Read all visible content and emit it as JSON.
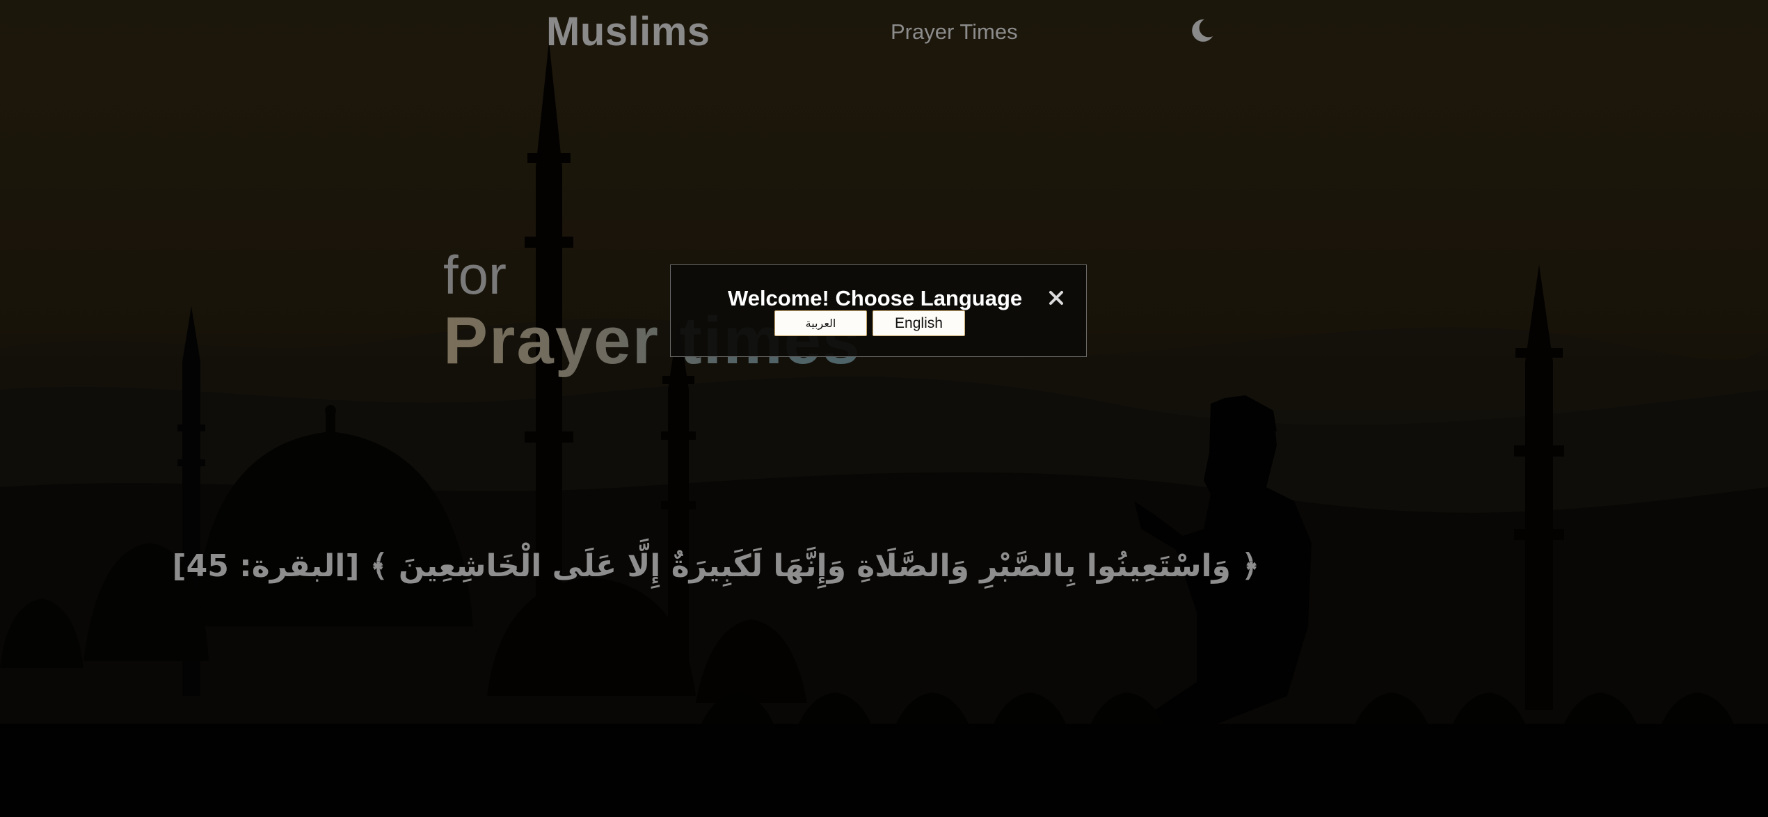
{
  "nav": {
    "brand": "Muslims",
    "links": [
      {
        "label": "Prayer Times"
      }
    ],
    "theme_toggle_icon": "moon-icon"
  },
  "hero": {
    "pre_title": "for",
    "title": "Prayer times"
  },
  "verse": {
    "text": "﴿ وَاسْتَعِينُوا بِالصَّبْرِ وَالصَّلَاةِ وَإِنَّهَا لَكَبِيرَةٌ إِلَّا عَلَى الْخَاشِعِينَ ﴾ [البقرة: 45]"
  },
  "modal": {
    "title": "Welcome! Choose Language",
    "close_icon": "close-icon",
    "buttons": {
      "arabic": "العربية",
      "english": "English"
    }
  },
  "colors": {
    "sky_top": "#2c2412",
    "silhouette": "#050403",
    "modal_bg": "#0c0b09",
    "button_border": "#c9a86a"
  }
}
